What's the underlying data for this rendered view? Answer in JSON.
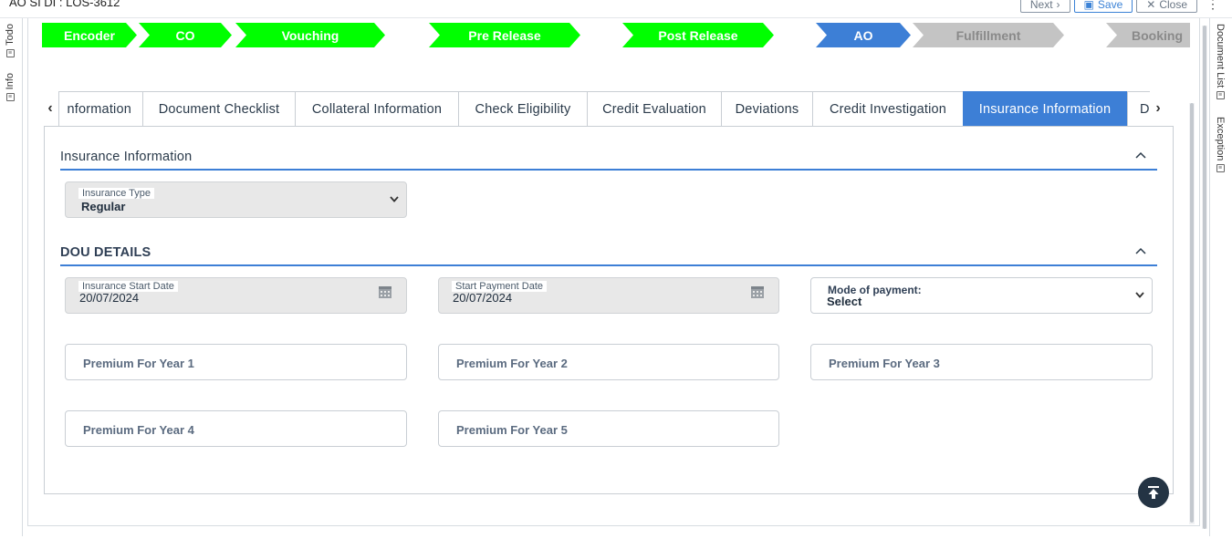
{
  "app": {
    "title": "AO SI DI : LOS-3612",
    "next_label": "Next",
    "save_label": "Save",
    "close_label": "Close"
  },
  "left_rail": {
    "todo_label": "Todo",
    "info_label": "Info"
  },
  "right_rail": {
    "document_list_label": "Document List",
    "exception_label": "Exception"
  },
  "stepper": {
    "done_color": "#00ff00",
    "active_color": "#3d7fd6",
    "pending_color": "#c4c4c4",
    "steps": [
      {
        "label": "Encoder",
        "state": "done"
      },
      {
        "label": "CO",
        "state": "done"
      },
      {
        "label": "Vouching",
        "state": "done"
      },
      {
        "label": "Pre Release",
        "state": "done"
      },
      {
        "label": "Post Release",
        "state": "done"
      },
      {
        "label": "AO",
        "state": "active"
      },
      {
        "label": "Fulfillment",
        "state": "pending"
      },
      {
        "label": "Booking",
        "state": "pending"
      }
    ]
  },
  "tabs": {
    "items": [
      {
        "label": "nformation",
        "active": false
      },
      {
        "label": "Document Checklist",
        "active": false
      },
      {
        "label": "Collateral Information",
        "active": false
      },
      {
        "label": "Check Eligibility",
        "active": false
      },
      {
        "label": "Credit Evaluation",
        "active": false
      },
      {
        "label": "Deviations",
        "active": false
      },
      {
        "label": "Credit Investigation",
        "active": false
      },
      {
        "label": "Insurance Information",
        "active": true
      },
      {
        "label": "D",
        "active": false
      }
    ]
  },
  "insurance_section": {
    "title": "Insurance Information",
    "insurance_type": {
      "label": "Insurance Type",
      "value": "Regular"
    }
  },
  "dou_section": {
    "title": "DOU DETAILS",
    "insurance_start_date": {
      "label": "Insurance Start Date",
      "value": "20/07/2024"
    },
    "start_payment_date": {
      "label": "Start Payment Date",
      "value": "20/07/2024"
    },
    "mode_of_payment": {
      "label": "Mode of payment:",
      "value": "Select"
    },
    "premium_year_1": {
      "placeholder": "Premium For Year 1"
    },
    "premium_year_2": {
      "placeholder": "Premium For Year 2"
    },
    "premium_year_3": {
      "placeholder": "Premium For Year 3"
    },
    "premium_year_4": {
      "placeholder": "Premium For Year 4"
    },
    "premium_year_5": {
      "placeholder": "Premium For Year 5"
    }
  },
  "icons": {
    "scroll_top": "arrow-to-top-icon",
    "calendar": "calendar-icon",
    "caret": "chevron-down-icon",
    "collapse": "chevron-up-icon"
  }
}
